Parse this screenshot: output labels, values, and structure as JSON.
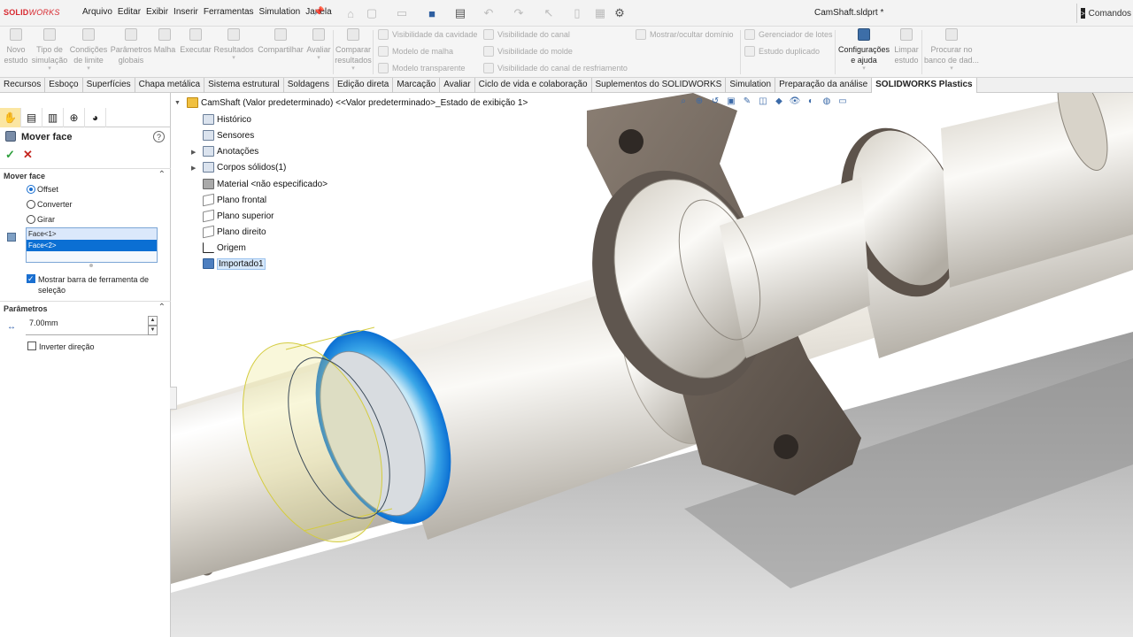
{
  "app": {
    "brand_bold": "SOLID",
    "brand_rest": "WORKS",
    "doc_title": "CamShaft.sldprt *",
    "commands_label": "Comandos"
  },
  "menu": [
    "Arquivo",
    "Editar",
    "Exibir",
    "Inserir",
    "Ferramentas",
    "Simulation",
    "Janela"
  ],
  "ribbon": {
    "buttons": [
      {
        "label": "Novo estudo",
        "state": "disabled"
      },
      {
        "label": "Tipo de simulação",
        "state": "disabled"
      },
      {
        "label": "Condições de limite",
        "state": "disabled"
      },
      {
        "label": "Parâmetros globais",
        "state": "disabled"
      },
      {
        "label": "Malha",
        "state": "disabled"
      },
      {
        "label": "Executar",
        "state": "disabled"
      },
      {
        "label": "Resultados",
        "state": "disabled"
      },
      {
        "label": "Compartilhar",
        "state": "disabled"
      },
      {
        "label": "Avaliar",
        "state": "disabled"
      },
      {
        "label": "Comparar resultados",
        "state": "disabled"
      },
      {
        "label": "Configurações e ajuda",
        "state": "active"
      },
      {
        "label": "Limpar estudo",
        "state": "disabled"
      },
      {
        "label": "Procurar no banco de dad...",
        "state": "disabled"
      }
    ],
    "small": [
      {
        "label": "Visibilidade da cavidade"
      },
      {
        "label": "Modelo de malha"
      },
      {
        "label": "Modelo transparente"
      },
      {
        "label": "Visibilidade do canal"
      },
      {
        "label": "Visibilidade do molde"
      },
      {
        "label": "Visibilidade do canal de resfriamento"
      },
      {
        "label": "Mostrar/ocultar domínio"
      },
      {
        "label": "Gerenciador de lotes"
      },
      {
        "label": "Estudo duplicado"
      }
    ]
  },
  "tabs": [
    "Recursos",
    "Esboço",
    "Superfícies",
    "Chapa metálica",
    "Sistema estrutural",
    "Soldagens",
    "Edição direta",
    "Marcação",
    "Avaliar",
    "Ciclo de vida e colaboração",
    "Suplementos do SOLIDWORKS",
    "Simulation",
    "Preparação da análise",
    "SOLIDWORKS Plastics"
  ],
  "active_tab": "SOLIDWORKS Plastics",
  "property_manager": {
    "title": "Mover face",
    "help": "?",
    "ok": "✓",
    "cancel": "✕",
    "section_move": "Mover face",
    "options": [
      "Offset",
      "Converter",
      "Girar"
    ],
    "selected_option": "Offset",
    "faces": [
      "Face<1>",
      "Face<2>"
    ],
    "show_toolbar_label": "Mostrar barra de ferramenta de seleção",
    "show_toolbar_checked": true,
    "section_params": "Parâmetros",
    "distance_value": "7.00mm",
    "invert_label": "Inverter direção",
    "invert_checked": false
  },
  "feature_tree": {
    "root": "CamShaft (Valor predeterminado) <<Valor predeterminado>_Estado de exibição 1>",
    "items": [
      {
        "label": "Histórico",
        "icon": "history-icon",
        "expandable": false
      },
      {
        "label": "Sensores",
        "icon": "sensors-icon",
        "expandable": false
      },
      {
        "label": "Anotações",
        "icon": "annotations-icon",
        "expandable": true
      },
      {
        "label": "Corpos sólidos(1)",
        "icon": "solid-bodies-icon",
        "expandable": true
      },
      {
        "label": "Material <não especificado>",
        "icon": "material-icon",
        "expandable": false
      },
      {
        "label": "Plano frontal",
        "icon": "plane-icon",
        "expandable": false
      },
      {
        "label": "Plano superior",
        "icon": "plane-icon",
        "expandable": false
      },
      {
        "label": "Plano direito",
        "icon": "plane-icon",
        "expandable": false
      },
      {
        "label": "Origem",
        "icon": "origin-icon",
        "expandable": false
      },
      {
        "label": "Importado1",
        "icon": "imported-icon",
        "expandable": false
      }
    ]
  },
  "colors": {
    "selection_blue": "#0b6fd3",
    "preview_yellow": "#e8e27a",
    "face_highlight": "#1e8fe6",
    "flange": "#6e6258",
    "shaft": "#dcd7cd"
  }
}
